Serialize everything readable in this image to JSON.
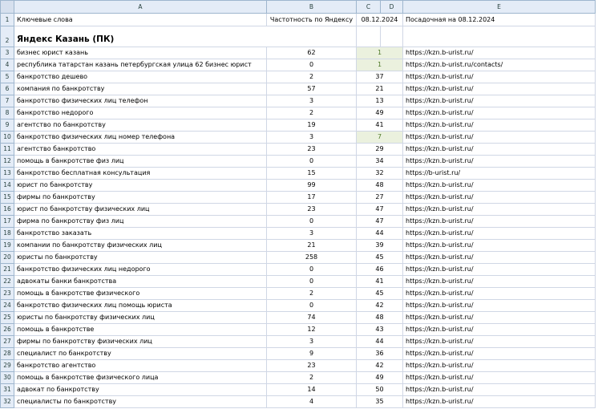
{
  "columns": [
    "A",
    "B",
    "C",
    "D",
    "E"
  ],
  "header": {
    "keywords": "Ключевые слова",
    "frequency": "Частотность по Яндексу",
    "date": "08.12.2024",
    "landing": "Посадочная на 08.12.2024"
  },
  "section_title": "Яндекс Казань (ПК)",
  "rows": [
    {
      "n": "3",
      "kw": "бизнес юрист казань",
      "freq": "62",
      "pos": "1",
      "url": "https://kzn.b-urist.ru/",
      "hl": true
    },
    {
      "n": "4",
      "kw": "республика татарстан казань петербургская улица 62 бизнес юрист",
      "freq": "0",
      "pos": "1",
      "url": "https://kzn.b-urist.ru/contacts/",
      "hl": true
    },
    {
      "n": "5",
      "kw": "банкротство дешево",
      "freq": "2",
      "pos": "37",
      "url": "https://kzn.b-urist.ru/",
      "hl": false
    },
    {
      "n": "6",
      "kw": "компания по банкротству",
      "freq": "57",
      "pos": "21",
      "url": "https://kzn.b-urist.ru/",
      "hl": false
    },
    {
      "n": "7",
      "kw": "банкротство физических лиц телефон",
      "freq": "3",
      "pos": "13",
      "url": "https://kzn.b-urist.ru/",
      "hl": false
    },
    {
      "n": "8",
      "kw": "банкротство недорого",
      "freq": "2",
      "pos": "49",
      "url": "https://kzn.b-urist.ru/",
      "hl": false
    },
    {
      "n": "9",
      "kw": "агентство по банкротству",
      "freq": "19",
      "pos": "41",
      "url": "https://kzn.b-urist.ru/",
      "hl": false
    },
    {
      "n": "10",
      "kw": "банкротство физических лиц номер телефона",
      "freq": "3",
      "pos": "7",
      "url": "https://kzn.b-urist.ru/",
      "hl": true
    },
    {
      "n": "11",
      "kw": "агентство банкротство",
      "freq": "23",
      "pos": "29",
      "url": "https://kzn.b-urist.ru/",
      "hl": false
    },
    {
      "n": "12",
      "kw": "помощь в банкротстве физ лиц",
      "freq": "0",
      "pos": "34",
      "url": "https://kzn.b-urist.ru/",
      "hl": false
    },
    {
      "n": "13",
      "kw": "банкротство бесплатная консультация",
      "freq": "15",
      "pos": "32",
      "url": "https://b-urist.ru/",
      "hl": false
    },
    {
      "n": "14",
      "kw": "юрист по банкротству",
      "freq": "99",
      "pos": "48",
      "url": "https://kzn.b-urist.ru/",
      "hl": false
    },
    {
      "n": "15",
      "kw": "фирмы по банкротству",
      "freq": "17",
      "pos": "27",
      "url": "https://kzn.b-urist.ru/",
      "hl": false
    },
    {
      "n": "16",
      "kw": "юрист по банкротству физических лиц",
      "freq": "23",
      "pos": "47",
      "url": "https://kzn.b-urist.ru/",
      "hl": false
    },
    {
      "n": "17",
      "kw": "фирма по банкротству физ лиц",
      "freq": "0",
      "pos": "47",
      "url": "https://kzn.b-urist.ru/",
      "hl": false
    },
    {
      "n": "18",
      "kw": "банкротство заказать",
      "freq": "3",
      "pos": "44",
      "url": "https://kzn.b-urist.ru/",
      "hl": false
    },
    {
      "n": "19",
      "kw": "компании по банкротству физических лиц",
      "freq": "21",
      "pos": "39",
      "url": "https://kzn.b-urist.ru/",
      "hl": false
    },
    {
      "n": "20",
      "kw": "юристы по банкротству",
      "freq": "258",
      "pos": "45",
      "url": "https://kzn.b-urist.ru/",
      "hl": false
    },
    {
      "n": "21",
      "kw": "банкротство физических лиц недорого",
      "freq": "0",
      "pos": "46",
      "url": "https://kzn.b-urist.ru/",
      "hl": false
    },
    {
      "n": "22",
      "kw": "адвокаты банки банкротства",
      "freq": "0",
      "pos": "41",
      "url": "https://kzn.b-urist.ru/",
      "hl": false
    },
    {
      "n": "23",
      "kw": "помощь в банкротстве физического",
      "freq": "2",
      "pos": "45",
      "url": "https://kzn.b-urist.ru/",
      "hl": false
    },
    {
      "n": "24",
      "kw": "банкротство физических лиц помощь юриста",
      "freq": "0",
      "pos": "42",
      "url": "https://kzn.b-urist.ru/",
      "hl": false
    },
    {
      "n": "25",
      "kw": "юристы по банкротству физических лиц",
      "freq": "74",
      "pos": "48",
      "url": "https://kzn.b-urist.ru/",
      "hl": false
    },
    {
      "n": "26",
      "kw": "помощь в банкротстве",
      "freq": "12",
      "pos": "43",
      "url": "https://kzn.b-urist.ru/",
      "hl": false
    },
    {
      "n": "27",
      "kw": "фирмы по банкротству физических лиц",
      "freq": "3",
      "pos": "44",
      "url": "https://kzn.b-urist.ru/",
      "hl": false
    },
    {
      "n": "28",
      "kw": "специалист по банкротству",
      "freq": "9",
      "pos": "36",
      "url": "https://kzn.b-urist.ru/",
      "hl": false
    },
    {
      "n": "29",
      "kw": "банкротство агентство",
      "freq": "23",
      "pos": "42",
      "url": "https://kzn.b-urist.ru/",
      "hl": false
    },
    {
      "n": "30",
      "kw": "помощь в банкротстве физического лица",
      "freq": "2",
      "pos": "49",
      "url": "https://kzn.b-urist.ru/",
      "hl": false
    },
    {
      "n": "31",
      "kw": "адвокат по банкротству",
      "freq": "14",
      "pos": "50",
      "url": "https://kzn.b-urist.ru/",
      "hl": false
    },
    {
      "n": "32",
      "kw": "специалисты по банкротству",
      "freq": "4",
      "pos": "35",
      "url": "https://kzn.b-urist.ru/",
      "hl": false
    }
  ]
}
